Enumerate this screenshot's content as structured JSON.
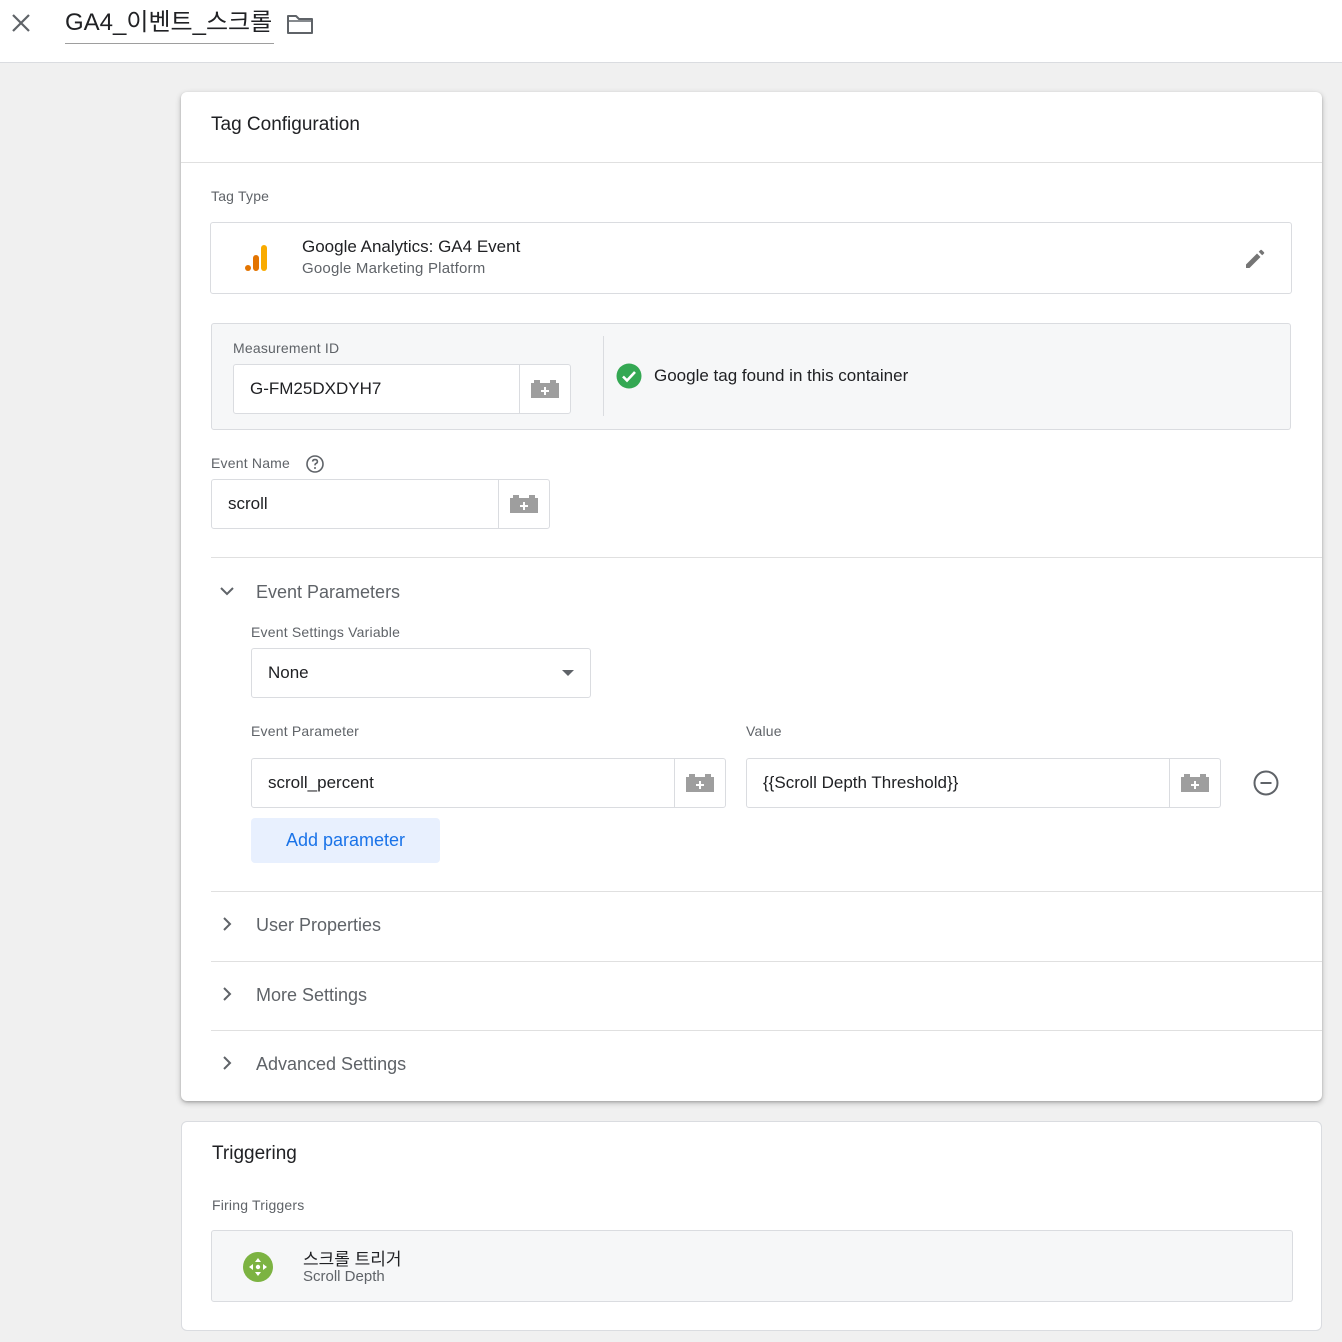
{
  "header": {
    "tag_name": "GA4_이벤트_스크롤",
    "close_icon": "close-icon",
    "folder_icon": "folder-icon"
  },
  "config": {
    "title": "Tag Configuration",
    "tag_type_label": "Tag Type",
    "tag_type": {
      "name": "Google Analytics: GA4 Event",
      "provider": "Google Marketing Platform",
      "icon": "google-analytics-icon"
    },
    "measurement": {
      "label": "Measurement ID",
      "value": "G-FM25DXDYH7",
      "status": "Google tag found in this container",
      "status_color": "#34a853"
    },
    "event_name": {
      "label": "Event Name",
      "value": "scroll"
    },
    "event_parameters": {
      "title": "Event Parameters",
      "settings_variable_label": "Event Settings Variable",
      "settings_variable_value": "None",
      "param_col_label": "Event Parameter",
      "value_col_label": "Value",
      "rows": [
        {
          "param": "scroll_percent",
          "value": "{{Scroll Depth Threshold}}"
        }
      ],
      "add_label": "Add parameter"
    },
    "collapsed_sections": [
      "User Properties",
      "More Settings",
      "Advanced Settings"
    ]
  },
  "triggering": {
    "title": "Triggering",
    "firing_label": "Firing Triggers",
    "trigger": {
      "name": "스크롤 트리거",
      "type": "Scroll Depth",
      "icon_color": "#7cb342"
    }
  },
  "colors": {
    "accent": "#1a73e8",
    "ga_orange": "#f9ab00",
    "ga_dark_orange": "#e37400"
  }
}
